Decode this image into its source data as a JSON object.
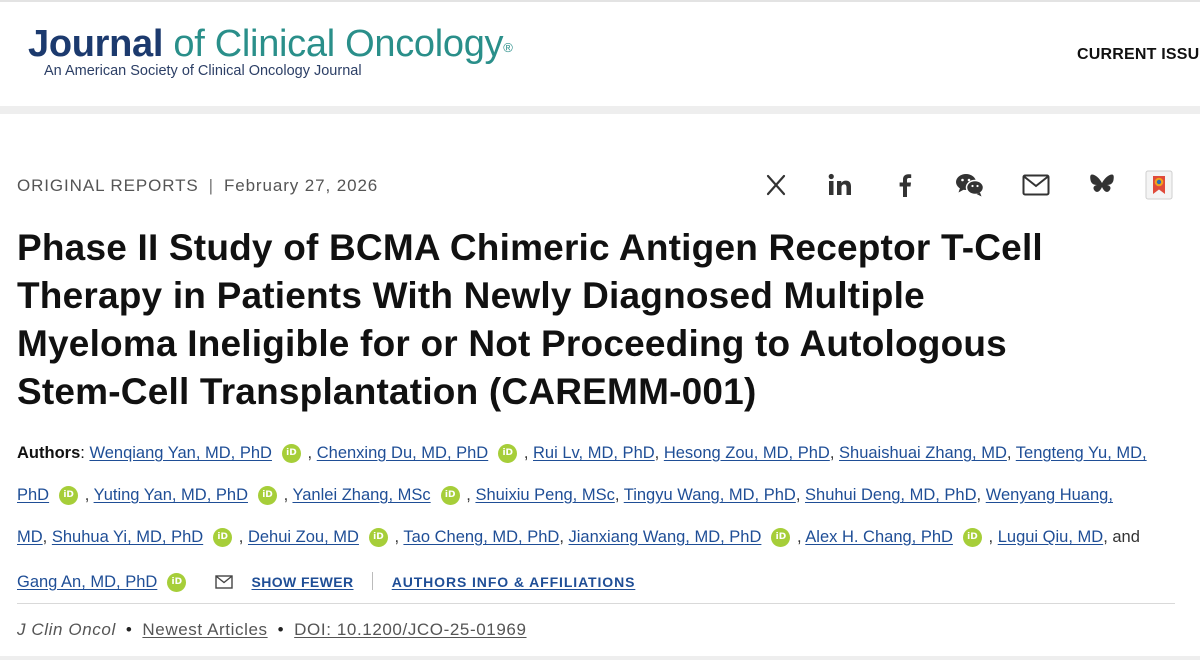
{
  "header": {
    "logo": {
      "word1": "Journal",
      "word2": "of Clinical Oncology",
      "registered": "®",
      "subtitle": "An American Society of Clinical Oncology Journal"
    },
    "nav_current_issue": "CURRENT ISSU"
  },
  "article": {
    "section": "ORIGINAL REPORTS",
    "separator": "|",
    "date": "February 27, 2026",
    "title_lines": [
      "Phase II Study of BCMA Chimeric Antigen Receptor T-Cell",
      "Therapy in Patients With Newly Diagnosed Multiple",
      "Myeloma Ineligible for or Not Proceeding to Autologous",
      "Stem-Cell Transplantation (CAREMM-001)"
    ]
  },
  "share": {
    "icons": [
      "x-icon",
      "linkedin-icon",
      "facebook-icon",
      "wechat-icon",
      "email-icon",
      "bluesky-icon",
      "bookmark-icon"
    ]
  },
  "authors": {
    "label": "Authors",
    "colon": ":",
    "comma": ",",
    "and": "and",
    "orcid_text": "iD",
    "list": [
      "Wenqiang Yan, MD, PhD",
      "Chenxing Du, MD, PhD",
      "Rui Lv, MD, PhD",
      "Hesong Zou, MD, PhD",
      "Shuaishuai Zhang, MD",
      "Tengteng Yu, MD,",
      "PhD",
      "Yuting Yan, MD, PhD",
      "Yanlei Zhang, MSc",
      "Shuixiu Peng, MSc",
      "Tingyu Wang, MD, PhD",
      "Shuhui Deng, MD, PhD",
      "Wenyang Huang,",
      "MD",
      "Shuhua Yi, MD, PhD",
      "Dehui Zou, MD",
      "Tao Cheng, MD, PhD",
      "Jianxiang Wang, MD, PhD",
      "Alex H. Chang, PhD",
      "Lugui Qiu, MD",
      "Gang An, MD, PhD"
    ],
    "show_fewer": "SHOW FEWER",
    "info_affiliations": "AUTHORS INFO & AFFILIATIONS"
  },
  "citation": {
    "journal": "J Clin Oncol",
    "bullet": "•",
    "newest": "Newest Articles",
    "doi": "DOI: 10.1200/JCO-25-01969"
  },
  "colors": {
    "navy": "#1c3a6e",
    "teal": "#2a8f8a",
    "link": "#1f4e96",
    "orcid": "#a6ce39"
  }
}
